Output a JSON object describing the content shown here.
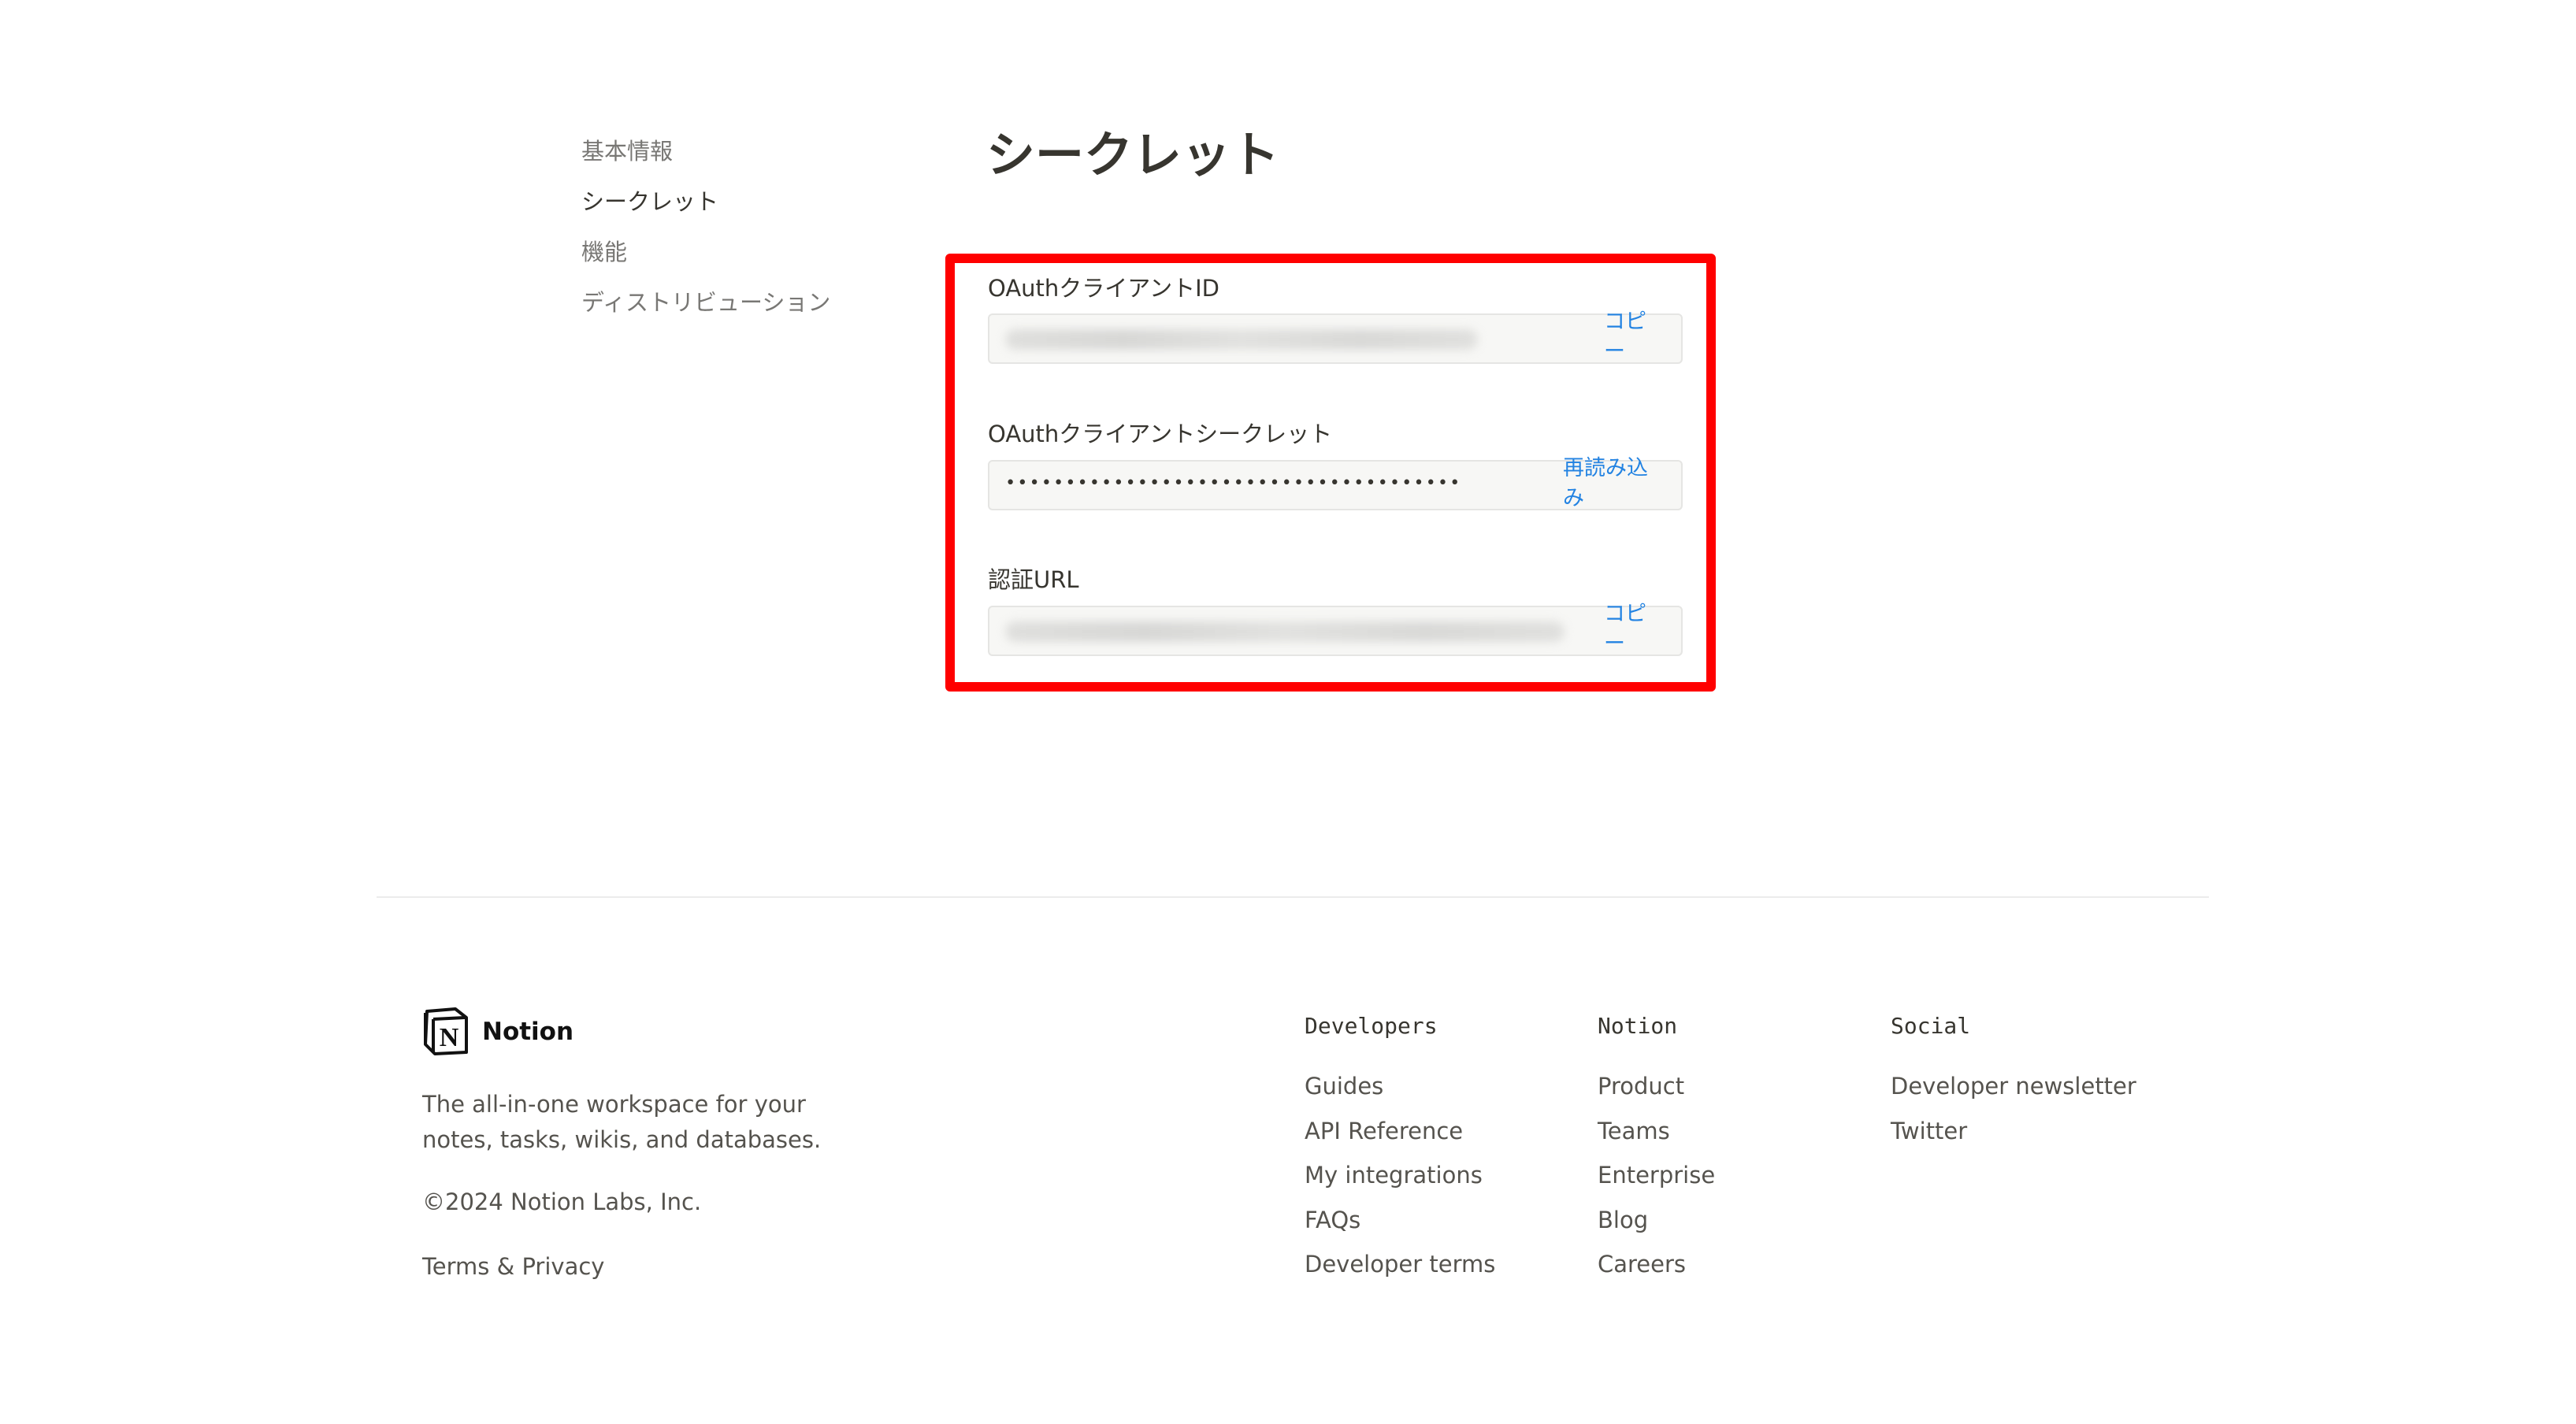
{
  "side_nav": {
    "items": [
      {
        "label": "基本情報",
        "active": false
      },
      {
        "label": "シークレット",
        "active": true
      },
      {
        "label": "機能",
        "active": false
      },
      {
        "label": "ディストリビューション",
        "active": false
      }
    ]
  },
  "page": {
    "title": "シークレット"
  },
  "fields": {
    "client_id": {
      "label": "OAuthクライアントID",
      "action": "コピー"
    },
    "client_secret": {
      "label": "OAuthクライアントシークレット",
      "masked_value": "••••••••••••••••••••••••••••••••••••••",
      "action": "再読み込み"
    },
    "auth_url": {
      "label": "認証URL",
      "action": "コピー"
    }
  },
  "footer": {
    "brand": "Notion",
    "tagline": "The all-in-one workspace for your notes, tasks, wikis, and databases.",
    "copyright": "©2024 Notion Labs, Inc.",
    "terms": "Terms & Privacy",
    "columns": [
      {
        "heading": "Developers",
        "links": [
          "Guides",
          "API Reference",
          "My integrations",
          "FAQs",
          "Developer terms"
        ]
      },
      {
        "heading": "Notion",
        "links": [
          "Product",
          "Teams",
          "Enterprise",
          "Blog",
          "Careers"
        ]
      },
      {
        "heading": "Social",
        "links": [
          "Developer newsletter",
          "Twitter"
        ]
      }
    ]
  },
  "colors": {
    "highlight": "#ff0000",
    "link": "#2383e2",
    "text": "#37352f",
    "muted": "#787774"
  },
  "icons": {
    "logo": "notion-logo-icon"
  }
}
